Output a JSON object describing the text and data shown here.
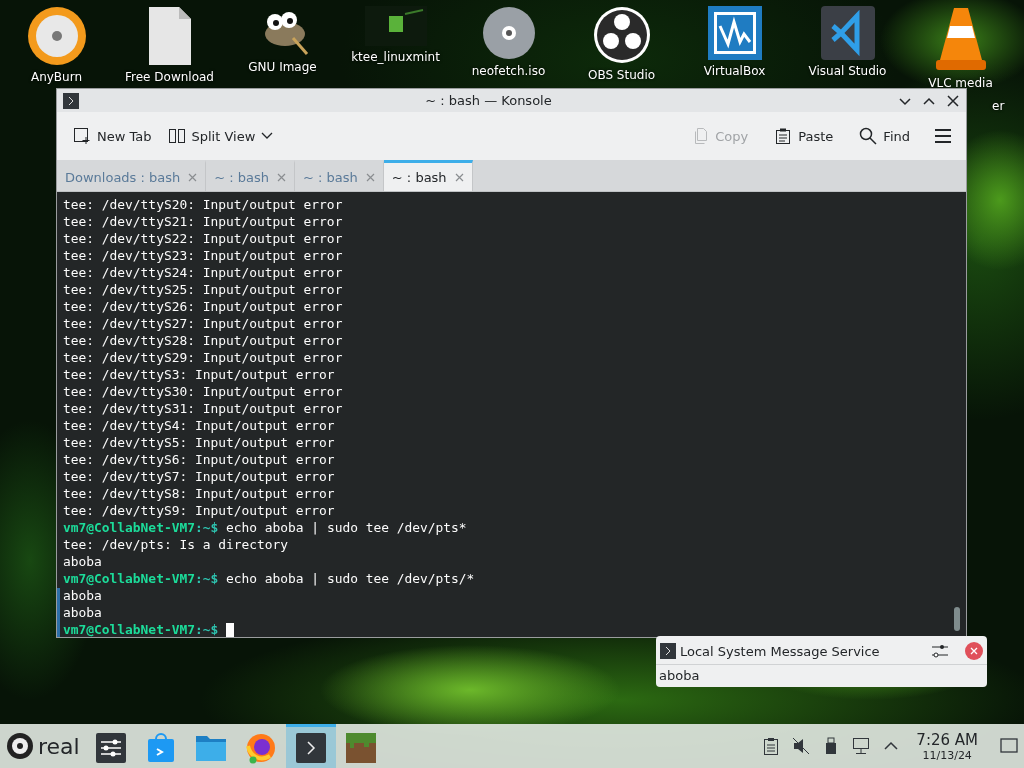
{
  "desktop_icons": [
    {
      "kind": "burn",
      "label": "AnyBurn"
    },
    {
      "kind": "file",
      "label": "Free Download"
    },
    {
      "kind": "gimp",
      "label": "GNU Image"
    },
    {
      "kind": "image",
      "label": "ktee_linuxmint"
    },
    {
      "kind": "disc",
      "label": "neofetch.iso"
    },
    {
      "kind": "obs",
      "label": "OBS Studio"
    },
    {
      "kind": "vbox",
      "label": "VirtualBox"
    },
    {
      "kind": "code",
      "label": "Visual Studio"
    },
    {
      "kind": "cone",
      "label": "VLC media",
      "label_2": "er"
    }
  ],
  "window": {
    "title": "~ : bash — Konsole",
    "toolbar": [
      {
        "kind": "new-tab",
        "label": "New Tab",
        "disabled": false
      },
      {
        "kind": "split",
        "label": "Split View",
        "disabled": false
      },
      {
        "kind": "copy",
        "label": "Copy",
        "disabled": true
      },
      {
        "kind": "paste",
        "label": "Paste",
        "disabled": false
      },
      {
        "kind": "find",
        "label": "Find",
        "disabled": false
      }
    ],
    "tabs": [
      {
        "label": "Downloads : bash",
        "selected": false
      },
      {
        "label": "~ : bash",
        "selected": false
      },
      {
        "label": "~ : bash",
        "selected": false
      },
      {
        "label": "~ : bash",
        "selected": true
      }
    ],
    "terminal": [
      {
        "kind": "output",
        "text": "tee: /dev/ttyS20: Input/output error",
        "marked": false
      },
      {
        "kind": "output",
        "text": "tee: /dev/ttyS21: Input/output error",
        "marked": false
      },
      {
        "kind": "output",
        "text": "tee: /dev/ttyS22: Input/output error",
        "marked": false
      },
      {
        "kind": "output",
        "text": "tee: /dev/ttyS23: Input/output error",
        "marked": false
      },
      {
        "kind": "output",
        "text": "tee: /dev/ttyS24: Input/output error",
        "marked": false
      },
      {
        "kind": "output",
        "text": "tee: /dev/ttyS25: Input/output error",
        "marked": false
      },
      {
        "kind": "output",
        "text": "tee: /dev/ttyS26: Input/output error",
        "marked": false
      },
      {
        "kind": "output",
        "text": "tee: /dev/ttyS27: Input/output error",
        "marked": false
      },
      {
        "kind": "output",
        "text": "tee: /dev/ttyS28: Input/output error",
        "marked": false
      },
      {
        "kind": "output",
        "text": "tee: /dev/ttyS29: Input/output error",
        "marked": false
      },
      {
        "kind": "output",
        "text": "tee: /dev/ttyS3: Input/output error",
        "marked": false
      },
      {
        "kind": "output",
        "text": "tee: /dev/ttyS30: Input/output error",
        "marked": false
      },
      {
        "kind": "output",
        "text": "tee: /dev/ttyS31: Input/output error",
        "marked": false
      },
      {
        "kind": "output",
        "text": "tee: /dev/ttyS4: Input/output error",
        "marked": false
      },
      {
        "kind": "output",
        "text": "tee: /dev/ttyS5: Input/output error",
        "marked": false
      },
      {
        "kind": "output",
        "text": "tee: /dev/ttyS6: Input/output error",
        "marked": false
      },
      {
        "kind": "output",
        "text": "tee: /dev/ttyS7: Input/output error",
        "marked": false
      },
      {
        "kind": "output",
        "text": "tee: /dev/ttyS8: Input/output error",
        "marked": false
      },
      {
        "kind": "output",
        "text": "tee: /dev/ttyS9: Input/output error",
        "marked": false
      },
      {
        "kind": "prompt",
        "prompt": "vm7@CollabNet-VM7",
        "path": ":~$",
        "text": "echo aboba | sudo tee /dev/pts*",
        "marked": false
      },
      {
        "kind": "output",
        "text": "tee: /dev/pts: Is a directory",
        "marked": false
      },
      {
        "kind": "output",
        "text": "aboba",
        "marked": false
      },
      {
        "kind": "prompt",
        "prompt": "vm7@CollabNet-VM7",
        "path": ":~$",
        "text": "echo aboba | sudo tee /dev/pts/*",
        "marked": false
      },
      {
        "kind": "output",
        "text": "aboba",
        "marked": true
      },
      {
        "kind": "output",
        "text": "aboba",
        "marked": true
      },
      {
        "kind": "prompt",
        "prompt": "vm7@CollabNet-VM7",
        "path": ":~$",
        "marked": true,
        "cursor": true
      }
    ]
  },
  "notification": {
    "title": "Local System Message Service",
    "body": "aboba"
  },
  "taskbar": {
    "start_label": "real",
    "tasks": [
      {
        "kind": "settings",
        "selected": false
      },
      {
        "kind": "store",
        "selected": false
      },
      {
        "kind": "folder",
        "selected": false
      },
      {
        "kind": "browser",
        "selected": false
      },
      {
        "kind": "terminal",
        "selected": true
      },
      {
        "kind": "block",
        "selected": false
      }
    ],
    "tray": [
      {
        "kind": "clipboard"
      },
      {
        "kind": "muted"
      },
      {
        "kind": "usb"
      },
      {
        "kind": "network"
      },
      {
        "kind": "expand"
      }
    ],
    "time": "7:26 AM",
    "date": "11/13/24"
  }
}
